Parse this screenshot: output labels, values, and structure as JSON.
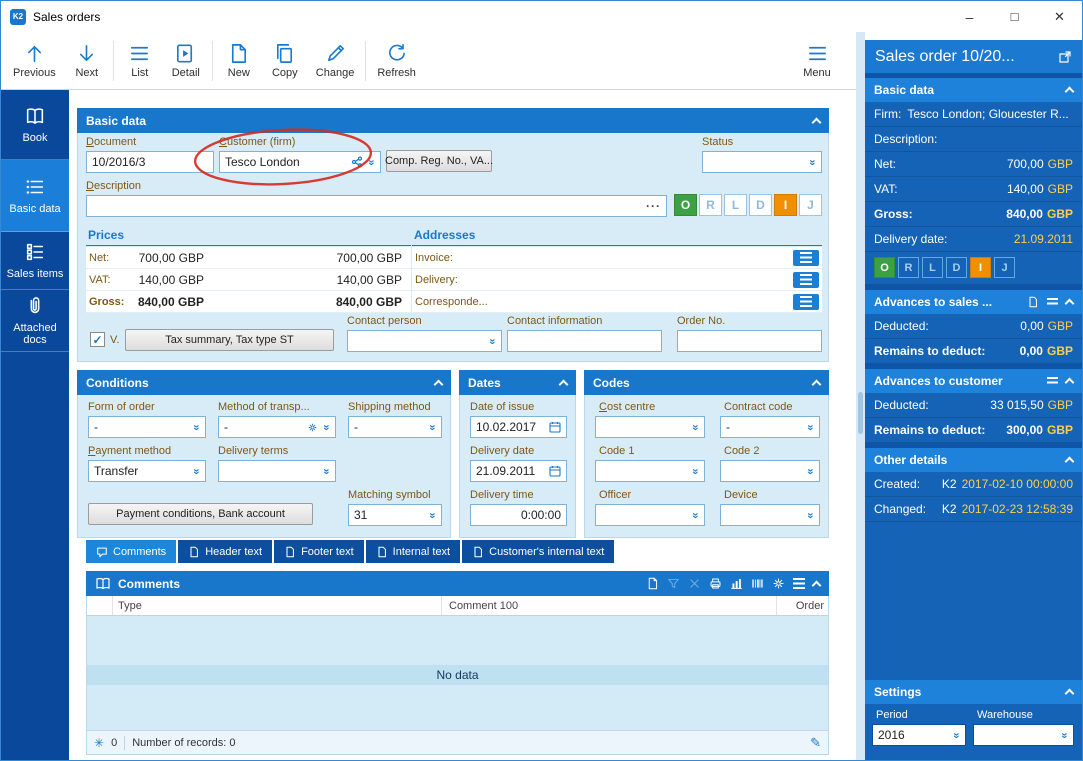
{
  "window": {
    "title": "Sales orders"
  },
  "toolbar": {
    "items": [
      {
        "label": "Previous"
      },
      {
        "label": "Next"
      },
      {
        "label": "List"
      },
      {
        "label": "Detail"
      },
      {
        "label": "New"
      },
      {
        "label": "Copy"
      },
      {
        "label": "Change"
      },
      {
        "label": "Refresh"
      }
    ],
    "menu_label": "Menu"
  },
  "sidebar": {
    "items": [
      {
        "label": "Book"
      },
      {
        "label": "Basic data"
      },
      {
        "label": "Sales items"
      },
      {
        "label": "Attached docs"
      }
    ]
  },
  "basic_panel": {
    "title": "Basic data",
    "document": {
      "label": "Document",
      "value": "10/2016/3"
    },
    "customer": {
      "label": "Customer (firm)",
      "value": "Tesco London"
    },
    "comp_reg_button": "Comp. Reg. No., VA...",
    "status": {
      "label": "Status",
      "value": ""
    },
    "description": {
      "label": "Description",
      "value": ""
    },
    "flags": [
      "O",
      "R",
      "L",
      "D",
      "I",
      "J"
    ],
    "prices": {
      "title": "Prices",
      "rows": [
        {
          "label": "Net:",
          "v1": "700,00 GBP",
          "v2": "700,00 GBP"
        },
        {
          "label": "VAT:",
          "v1": "140,00 GBP",
          "v2": "140,00 GBP"
        },
        {
          "label": "Gross:",
          "v1": "840,00 GBP",
          "v2": "840,00 GBP"
        }
      ]
    },
    "addresses": {
      "title": "Addresses",
      "rows": [
        {
          "label": "Invoice:"
        },
        {
          "label": "Delivery:"
        },
        {
          "label": "Corresponde..."
        }
      ]
    },
    "contact_person": {
      "label": "Contact person",
      "value": ""
    },
    "contact_information": {
      "label": "Contact information",
      "value": ""
    },
    "order_no": {
      "label": "Order No.",
      "value": ""
    },
    "vat_checkbox_label": "V.",
    "tax_button": "Tax summary, Tax type ST"
  },
  "conditions": {
    "title": "Conditions",
    "form_of_order": {
      "label": "Form of order",
      "value": "-"
    },
    "method_of_transport": {
      "label": "Method of transp...",
      "value": "-"
    },
    "shipping_method": {
      "label": "Shipping method",
      "value": "-"
    },
    "payment_method": {
      "label": "Payment method",
      "value": "Transfer"
    },
    "delivery_terms": {
      "label": "Delivery terms",
      "value": ""
    },
    "matching_symbol": {
      "label": "Matching symbol",
      "value": "31"
    },
    "payment_conditions_button": "Payment conditions, Bank account"
  },
  "dates": {
    "title": "Dates",
    "date_of_issue": {
      "label": "Date of issue",
      "value": "10.02.2017"
    },
    "delivery_date": {
      "label": "Delivery date",
      "value": "21.09.2011"
    },
    "delivery_time": {
      "label": "Delivery time",
      "value": "0:00:00"
    }
  },
  "codes": {
    "title": "Codes",
    "cost_centre": {
      "label": "Cost centre",
      "value": ""
    },
    "contract_code": {
      "label": "Contract code",
      "value": "-"
    },
    "code1": {
      "label": "Code 1",
      "value": ""
    },
    "code2": {
      "label": "Code 2",
      "value": ""
    },
    "officer": {
      "label": "Officer",
      "value": ""
    },
    "device": {
      "label": "Device",
      "value": ""
    }
  },
  "tabs": [
    {
      "label": "Comments"
    },
    {
      "label": "Header text"
    },
    {
      "label": "Footer text"
    },
    {
      "label": "Internal text"
    },
    {
      "label": "Customer's internal text"
    }
  ],
  "comments": {
    "title": "Comments",
    "columns": [
      "Type",
      "Comment 100",
      "Order"
    ],
    "empty": "No data",
    "count": "0",
    "records": "Number of records: 0"
  },
  "right_panel": {
    "title": "Sales order 10/20...",
    "basic": {
      "title": "Basic data",
      "firm_label": "Firm:",
      "firm_value": "Tesco London; Gloucester R...",
      "description_label": "Description:",
      "description_value": "",
      "net_label": "Net:",
      "net_value": "700,00",
      "vat_label": "VAT:",
      "vat_value": "140,00",
      "gross_label": "Gross:",
      "gross_value": "840,00",
      "currency": "GBP",
      "delivery_date_label": "Delivery date:",
      "delivery_date_value": "21.09.2011",
      "flags": [
        "O",
        "R",
        "L",
        "D",
        "I",
        "J"
      ]
    },
    "advances_sales": {
      "title": "Advances to sales ...",
      "deducted_label": "Deducted:",
      "deducted_value": "0,00",
      "remains_label": "Remains to deduct:",
      "remains_value": "0,00",
      "currency": "GBP"
    },
    "advances_customer": {
      "title": "Advances to customer",
      "deducted_label": "Deducted:",
      "deducted_value": "33 015,50",
      "remains_label": "Remains to deduct:",
      "remains_value": "300,00",
      "currency": "GBP"
    },
    "other": {
      "title": "Other details",
      "created_label": "Created:",
      "created_user": "K2",
      "created_value": "2017-02-10 00:00:00",
      "changed_label": "Changed:",
      "changed_user": "K2",
      "changed_value": "2017-02-23 12:58:39"
    },
    "settings": {
      "title": "Settings",
      "period_label": "Period",
      "period_value": "2016",
      "warehouse_label": "Warehouse",
      "warehouse_value": ""
    }
  },
  "colors": {
    "accent_blue": "#1877cb",
    "sidebar_blue": "#09489a",
    "right_panel_blue": "#1463b6",
    "green_flag": "#3ea044",
    "orange_flag": "#f08f00",
    "gold_text": "#ffd04a",
    "label_brown": "#7d5715",
    "annotation_red": "#d52b1e"
  }
}
